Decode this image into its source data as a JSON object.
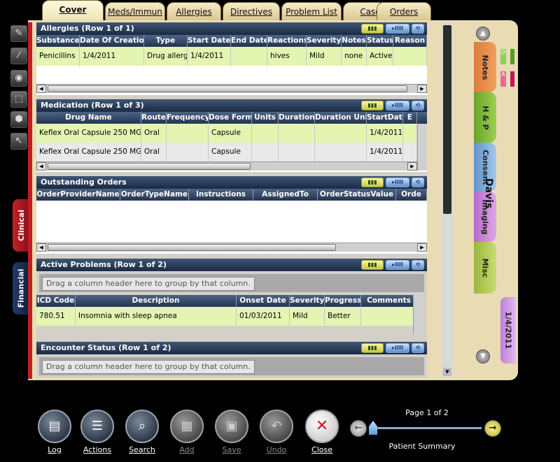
{
  "tabs": [
    {
      "label": "Cover",
      "active": true
    },
    {
      "label": "Meds/Immun"
    },
    {
      "label": "Allergies"
    },
    {
      "label": "Directives"
    },
    {
      "label": "Problem List"
    },
    {
      "label": "Case"
    },
    {
      "label": "Orders"
    }
  ],
  "left_tools": [
    "pen-icon",
    "brush-icon",
    "tape-icon",
    "select-region-icon",
    "eraser-icon",
    "arrow-cursor-icon"
  ],
  "side_tabs": {
    "clinical": "Clinical",
    "financial": "Financial"
  },
  "allergies": {
    "title": "Allergies (Row 1 of 1)",
    "columns": [
      "Substance",
      "Date Of Creation",
      "Type",
      "Start Date",
      "End Date",
      "Reactions",
      "Severity",
      "Notes",
      "Status",
      "Reason"
    ],
    "rows": [
      [
        "Penicillins",
        "1/4/2011",
        "Drug allergy",
        "1/4/2011",
        "",
        "hives",
        "Mild",
        "none",
        "Active",
        ""
      ]
    ]
  },
  "medication": {
    "title": "Medication (Row 1 of 3)",
    "columns": [
      "Drug Name",
      "Route",
      "Frequency",
      "Dose Form",
      "Units",
      "Duration",
      "Duration Unit",
      "StartDate",
      "E"
    ],
    "rows": [
      [
        "Keflex Oral Capsule 250 MG",
        "Oral",
        "",
        "Capsule",
        "",
        "",
        "",
        "1/4/2011",
        ""
      ],
      [
        "Keflex Oral Capsule 250 MG",
        "Oral",
        "",
        "Capsule",
        "",
        "",
        "",
        "1/4/2011",
        ""
      ]
    ]
  },
  "outstanding_orders": {
    "title": "Outstanding Orders",
    "columns": [
      "OrderProviderName",
      "OrderTypeName",
      "Instructions",
      "AssignedTo",
      "OrderStatusValue",
      "Orde"
    ]
  },
  "active_problems": {
    "title": "Active Problems (Row 1 of 2)",
    "group_hint": "Drag a column header here to group by that column.",
    "columns": [
      "ICD Code",
      "Description",
      "Onset Date",
      "Severity",
      "Progress",
      "Comments"
    ],
    "rows": [
      [
        "780.51",
        "Insomnia with sleep apnea",
        "01/03/2011",
        "Mild",
        "Better",
        ""
      ]
    ]
  },
  "encounter_status": {
    "title": "Encounter Status (Row 1 of 2)",
    "group_hint": "Drag a column header here to group by that column."
  },
  "right": {
    "patient_name": "Davis",
    "tabs": [
      "Notes",
      "H & P",
      "Consent",
      "Imaging",
      "Misc",
      "1/4/2011"
    ],
    "mini_d": "D",
    "mini_a": "A"
  },
  "bottom": {
    "buttons": [
      {
        "label": "Log",
        "icon": "log-icon",
        "enabled": true
      },
      {
        "label": "Actions",
        "icon": "actions-icon",
        "enabled": true
      },
      {
        "label": "Search",
        "icon": "search-icon",
        "enabled": true
      },
      {
        "label": "Add",
        "icon": "add-icon",
        "enabled": false
      },
      {
        "label": "Save",
        "icon": "save-icon",
        "enabled": false
      },
      {
        "label": "Undo",
        "icon": "undo-icon",
        "enabled": false
      },
      {
        "label": "Close",
        "icon": "close-icon",
        "enabled": true
      }
    ],
    "page_label": "Page 1 of 2",
    "pager_caption": "Patient Summary"
  }
}
